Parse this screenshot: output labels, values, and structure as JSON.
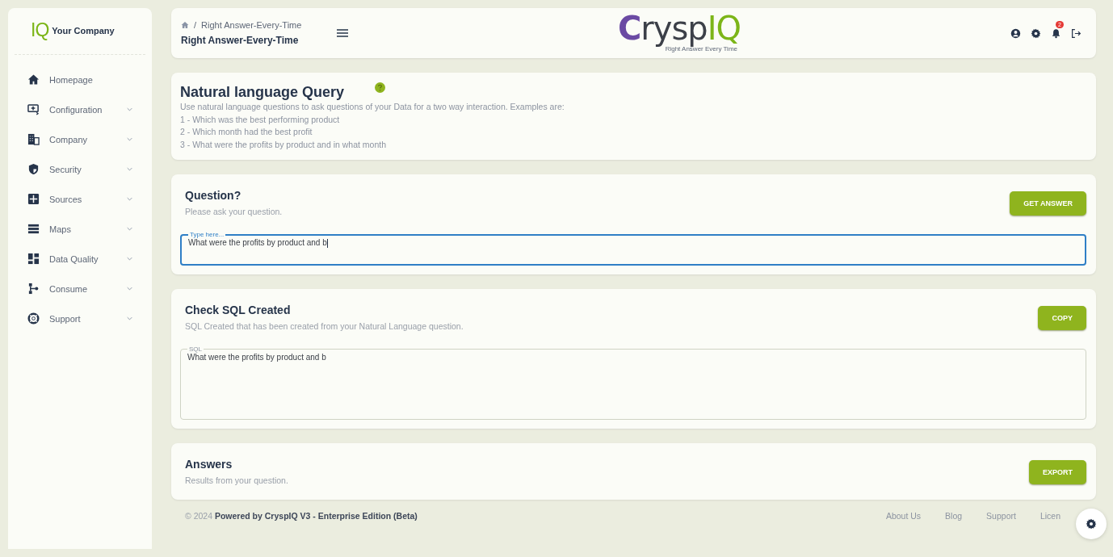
{
  "sidebar": {
    "logo": {
      "mark": "IQ",
      "name": "Your Company"
    },
    "items": [
      {
        "label": "Homepage",
        "kind": "link"
      },
      {
        "label": "Configuration",
        "kind": "group"
      },
      {
        "label": "Company",
        "kind": "group"
      },
      {
        "label": "Security",
        "kind": "group"
      },
      {
        "label": "Sources",
        "kind": "group"
      },
      {
        "label": "Maps",
        "kind": "group"
      },
      {
        "label": "Data Quality",
        "kind": "group"
      },
      {
        "label": "Consume",
        "kind": "group"
      },
      {
        "label": "Support",
        "kind": "group"
      }
    ]
  },
  "header": {
    "breadcrumb_separator": "/",
    "breadcrumb": [
      "Right Answer-Every-Time"
    ],
    "title": "Right Answer-Every-Time",
    "logo": {
      "first": "C",
      "middle": "rysp",
      "last": "IQ",
      "tagline": "Right Answer Every Time"
    },
    "notification_count": "2"
  },
  "intro": {
    "title": "Natural language Query",
    "lines": [
      "Use natural language questions to ask questions of your Data for a two way interaction. Examples are:",
      "1 - Which was the best performing product",
      "2 - Which month had the best profit",
      "3 - What were the profits by product and in what month"
    ]
  },
  "question": {
    "title": "Question?",
    "subtitle": "Please ask your question.",
    "button": "GET ANSWER",
    "field": {
      "label": "Type here...",
      "value": "What were the profits by product and b",
      "focused": true
    }
  },
  "sql": {
    "title": "Check SQL Created",
    "subtitle": "SQL Created that has been created from your Natural Language question.",
    "button": "COPY",
    "field": {
      "label": "SQL",
      "value": "What were the profits by product and b",
      "focused": false
    }
  },
  "answers": {
    "title": "Answers",
    "subtitle": "Results from your question.",
    "button": "EXPORT"
  },
  "footer": {
    "copyright": "© 2024",
    "powered": "Powered by CryspIQ V3 - Enterprise Edition (Beta)",
    "links": [
      "About Us",
      "Blog",
      "Support",
      "Licen"
    ]
  }
}
